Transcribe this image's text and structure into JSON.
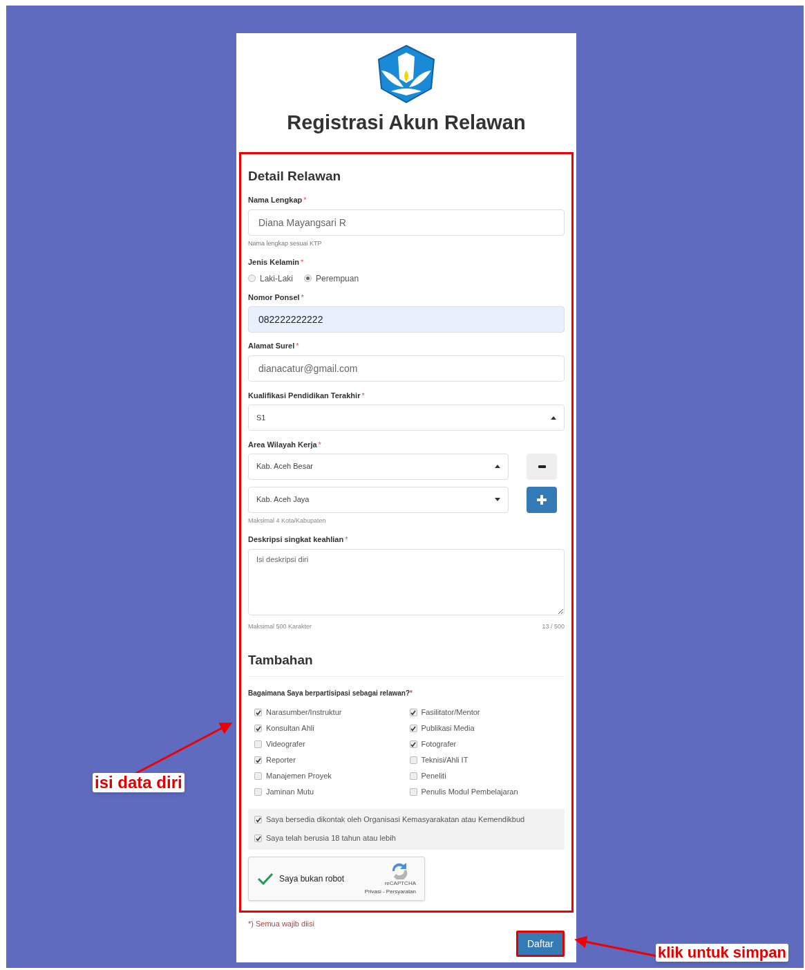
{
  "header": {
    "title": "Registrasi Akun Relawan"
  },
  "detail": {
    "heading": "Detail Relawan",
    "name": {
      "label": "Nama Lengkap",
      "required": "*",
      "value": "Diana Mayangsari R",
      "autofilled": false,
      "help": "Nama lengkap sesuai KTP"
    },
    "gender": {
      "label": "Jenis Kelamin",
      "required": "*",
      "options": [
        {
          "label": "Laki-Laki",
          "selected": false
        },
        {
          "label": "Perempuan",
          "selected": true
        }
      ]
    },
    "phone": {
      "label": "Nomor Ponsel",
      "required": "*",
      "value": "082222222222",
      "autofilled": true
    },
    "email": {
      "label": "Alamat Surel",
      "required": "*",
      "value": "dianacatur@gmail.com",
      "autofilled": false
    },
    "education": {
      "label": "Kualifikasi Pendidikan Terakhir",
      "required": "*",
      "value": "S1",
      "expanded": true
    },
    "areas": {
      "label": "Area Wilayah Kerja",
      "required": "*",
      "items": [
        {
          "value": "Kab. Aceh Besar",
          "expanded": true,
          "kind": "remove"
        },
        {
          "value": "Kab. Aceh Jaya",
          "expanded": false,
          "kind": "add"
        }
      ],
      "help": "Maksimal 4 Kota/Kabupaten"
    },
    "description": {
      "label": "Deskripsi singkat keahlian",
      "required": "*",
      "placeholder": "Isi deskripsi diri",
      "help": "Maksimal 500 Karakter",
      "counter": "13 / 500"
    }
  },
  "extra": {
    "heading": "Tambahan",
    "question": "Bagaimana Saya berpartisipasi sebagai relawan?",
    "required": "*",
    "roles": [
      {
        "label": "Narasumber/Instruktur",
        "checked": true
      },
      {
        "label": "Fasilitator/Mentor",
        "checked": true
      },
      {
        "label": "Konsultan Ahli",
        "checked": true
      },
      {
        "label": "Publikasi Media",
        "checked": true
      },
      {
        "label": "Videografer",
        "checked": false
      },
      {
        "label": "Fotografer",
        "checked": true
      },
      {
        "label": "Reporter",
        "checked": true
      },
      {
        "label": "Teknisi/Ahli IT",
        "checked": false
      },
      {
        "label": "Manajemen Proyek",
        "checked": false
      },
      {
        "label": "Peneliti",
        "checked": false
      },
      {
        "label": "Jaminan Mutu",
        "checked": false
      },
      {
        "label": "Penulis Modul Pembelajaran",
        "checked": false
      }
    ],
    "consents": [
      {
        "label": "Saya bersedia dikontak oleh Organisasi Kemasyarakatan atau Kemendikbud",
        "checked": true
      },
      {
        "label": "Saya telah berusia 18 tahun atau lebih",
        "checked": true
      }
    ],
    "captcha": {
      "label": "Saya bukan robot",
      "checked": true,
      "brand": "reCAPTCHA",
      "links": "Privasi - Persyaratan"
    }
  },
  "footer": {
    "note": "*) Semua wajib diisi",
    "submit": "Daftar"
  },
  "annotations": [
    {
      "text": "isi data diri"
    },
    {
      "text": "klik untuk simpan"
    }
  ]
}
